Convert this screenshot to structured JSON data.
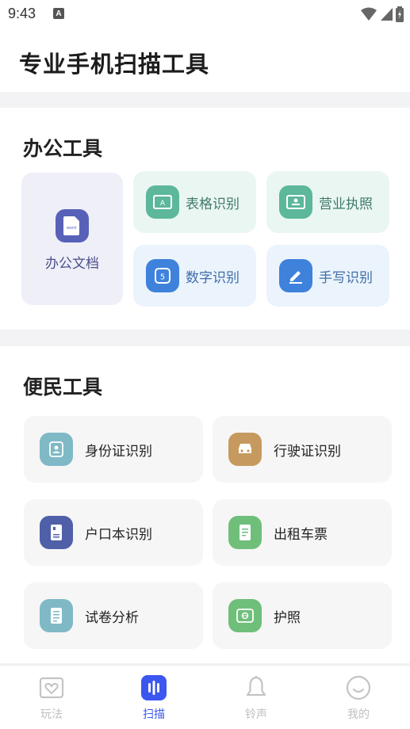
{
  "status_bar": {
    "time": "9:43",
    "notification_badge": "A"
  },
  "header": {
    "title": "专业手机扫描工具"
  },
  "office_tools": {
    "title": "办公工具",
    "featured": {
      "label": "办公文档",
      "icon": "word-doc-icon",
      "icon_text": "word"
    },
    "items": [
      {
        "label": "表格识别",
        "icon": "table-recognition-icon",
        "icon_text": "A"
      },
      {
        "label": "营业执照",
        "icon": "business-license-icon"
      },
      {
        "label": "数字识别",
        "icon": "number-recognition-icon",
        "icon_text": "5"
      },
      {
        "label": "手写识别",
        "icon": "handwriting-icon"
      }
    ]
  },
  "life_tools": {
    "title": "便民工具",
    "items": [
      {
        "label": "身份证识别",
        "icon": "id-card-icon"
      },
      {
        "label": "行驶证识别",
        "icon": "car-icon"
      },
      {
        "label": "户口本识别",
        "icon": "household-register-icon"
      },
      {
        "label": "出租车票",
        "icon": "taxi-receipt-icon"
      },
      {
        "label": "试卷分析",
        "icon": "exam-paper-icon"
      },
      {
        "label": "护照",
        "icon": "passport-icon"
      }
    ]
  },
  "tab_bar": {
    "tabs": [
      {
        "label": "玩法",
        "icon": "heart-frame-icon",
        "active": false
      },
      {
        "label": "扫描",
        "icon": "scan-bars-icon",
        "active": true
      },
      {
        "label": "铃声",
        "icon": "bell-icon",
        "active": false
      },
      {
        "label": "我的",
        "icon": "smiley-icon",
        "active": false
      }
    ]
  },
  "colors": {
    "accent": "#3b57f0",
    "office_featured_bg": "#efeff8",
    "green_tile_bg": "#eaf6f2",
    "blue_tile_bg": "#ebf3fc",
    "life_tile_bg": "#f6f6f6"
  }
}
